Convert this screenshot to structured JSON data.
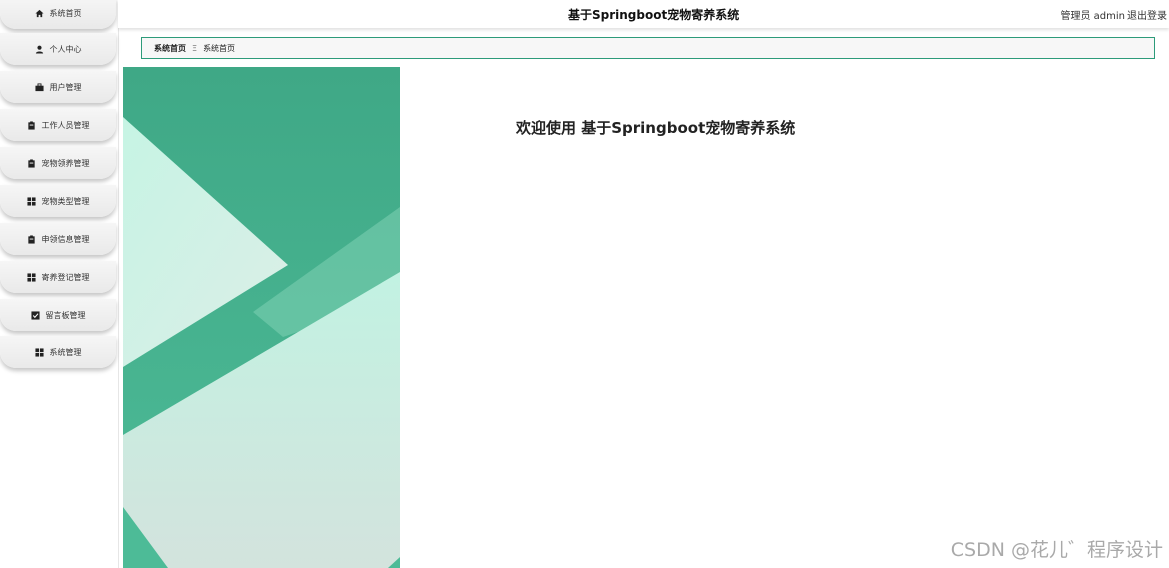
{
  "sidebar": {
    "items": [
      {
        "label": "系统首页",
        "icon": "home-icon"
      },
      {
        "label": "个人中心",
        "icon": "user-icon"
      },
      {
        "label": "用户管理",
        "icon": "briefcase-icon"
      },
      {
        "label": "工作人员管理",
        "icon": "clipboard-icon"
      },
      {
        "label": "宠物领养管理",
        "icon": "clipboard-icon"
      },
      {
        "label": "宠物类型管理",
        "icon": "grid-icon"
      },
      {
        "label": "申领信息管理",
        "icon": "clipboard-icon"
      },
      {
        "label": "寄养登记管理",
        "icon": "grid-icon"
      },
      {
        "label": "留言板管理",
        "icon": "checkbox-icon"
      },
      {
        "label": "系统管理",
        "icon": "grid-icon"
      }
    ]
  },
  "header": {
    "title": "基于Springboot宠物寄养系统",
    "user": "管理员 admin",
    "logout": "退出登录"
  },
  "breadcrumb": {
    "home": "系统首页",
    "separator": "Ξ",
    "current": "系统首页"
  },
  "main": {
    "welcome": "欢迎使用 基于Springboot宠物寄养系统"
  },
  "watermark": "CSDN @花儿゛程序设计",
  "colors": {
    "accent": "#2d9b7a",
    "banner_dark": "#4dbb97",
    "banner_light": "#c2f2e2"
  }
}
